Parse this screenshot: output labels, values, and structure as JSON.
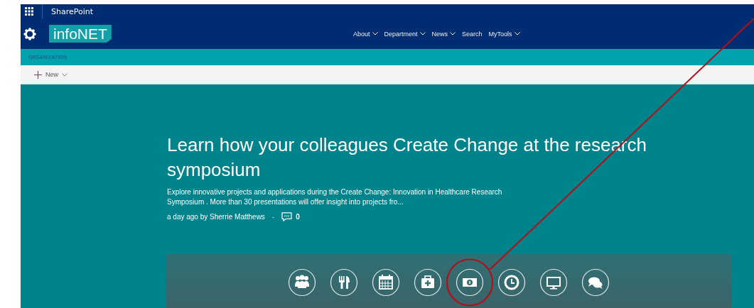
{
  "suite_bar": {
    "app_name": "SharePoint"
  },
  "header": {
    "site_title": "infoNET",
    "nav": [
      {
        "label": "About",
        "dropdown": true
      },
      {
        "label": "Department",
        "dropdown": true
      },
      {
        "label": "News",
        "dropdown": true
      },
      {
        "label": "Search",
        "dropdown": false
      },
      {
        "label": "MyTools",
        "dropdown": true
      }
    ]
  },
  "breadcrumb": "ORGANIZATION",
  "command_bar": {
    "new_label": "New"
  },
  "hero": {
    "title": "Learn how your colleagues Create Change at the research symposium",
    "description": "Explore innovative projects and applications during the Create Change: Innovation in Healthcare Research Symposium . More than 30 presentations will offer insight into projects fro...",
    "byline": "a day ago by Sherrie Matthews",
    "separator": "-",
    "comment_count": "0"
  },
  "quick_links": [
    {
      "kind": "people",
      "circled": false
    },
    {
      "kind": "dining",
      "circled": false
    },
    {
      "kind": "calendar",
      "circled": false
    },
    {
      "kind": "firstaid",
      "circled": false
    },
    {
      "kind": "money",
      "circled": true
    },
    {
      "kind": "clock",
      "circled": false
    },
    {
      "kind": "monitor",
      "circled": false
    },
    {
      "kind": "chat",
      "circled": false
    }
  ]
}
